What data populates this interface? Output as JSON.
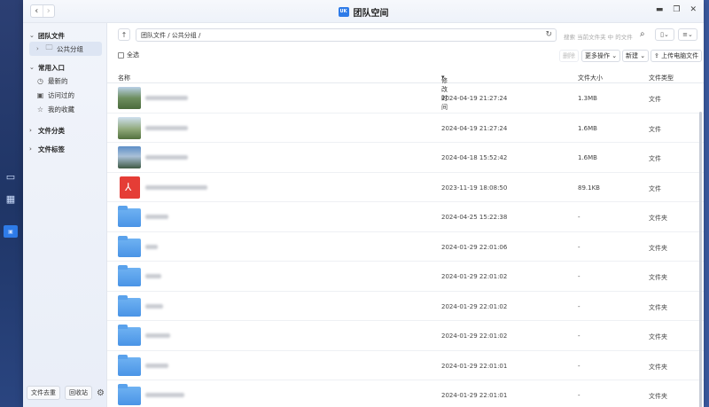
{
  "window": {
    "title": "团队空间",
    "logo_text": "UK",
    "nav_back": "‹",
    "nav_forward": "›"
  },
  "sidebar": {
    "team_files": "团队文件",
    "public_group": "公共分组",
    "common_entry": "常用入口",
    "recent": "最新的",
    "visited": "访问过的",
    "favorites": "我的收藏",
    "file_category": "文件分类",
    "file_tags": "文件标签",
    "dedupe_button": "文件去重",
    "recycle_button": "回收站"
  },
  "toolbar": {
    "path": "团队文件 / 公共分组 /",
    "search_placeholder": "搜索 当前文件夹 中 的文件",
    "select_all": "全选",
    "delete": "删除",
    "more": "更多操作",
    "new": "新建",
    "upload": "上传电脑文件"
  },
  "table": {
    "headers": {
      "name": "名称",
      "modified": "修改时间",
      "size": "文件大小",
      "type": "文件类型"
    },
    "rows": [
      {
        "kind": "photo1",
        "name_w": 48,
        "modified": "2024-04-19 21:27:24",
        "size": "1.3MB",
        "type": "文件"
      },
      {
        "kind": "photo2",
        "name_w": 48,
        "modified": "2024-04-19 21:27:24",
        "size": "1.6MB",
        "type": "文件"
      },
      {
        "kind": "photo3",
        "name_w": 48,
        "modified": "2024-04-18 15:52:42",
        "size": "1.6MB",
        "type": "文件"
      },
      {
        "kind": "pdf",
        "name_w": 70,
        "modified": "2023-11-19 18:08:50",
        "size": "89.1KB",
        "type": "文件"
      },
      {
        "kind": "folder",
        "name_w": 26,
        "modified": "2024-04-25 15:22:38",
        "size": "-",
        "type": "文件夹"
      },
      {
        "kind": "folder",
        "name_w": 14,
        "modified": "2024-01-29 22:01:06",
        "size": "-",
        "type": "文件夹"
      },
      {
        "kind": "folder",
        "name_w": 18,
        "modified": "2024-01-29 22:01:02",
        "size": "-",
        "type": "文件夹"
      },
      {
        "kind": "folder",
        "name_w": 20,
        "modified": "2024-01-29 22:01:02",
        "size": "-",
        "type": "文件夹"
      },
      {
        "kind": "folder",
        "name_w": 28,
        "modified": "2024-01-29 22:01:02",
        "size": "-",
        "type": "文件夹"
      },
      {
        "kind": "folder",
        "name_w": 26,
        "modified": "2024-01-29 22:01:01",
        "size": "-",
        "type": "文件夹"
      },
      {
        "kind": "folder",
        "name_w": 44,
        "modified": "2024-01-29 22:01:01",
        "size": "-",
        "type": "文件夹"
      }
    ]
  },
  "icons": {
    "refresh": "refresh-icon",
    "search": "search-icon",
    "gear": "gear-icon"
  }
}
